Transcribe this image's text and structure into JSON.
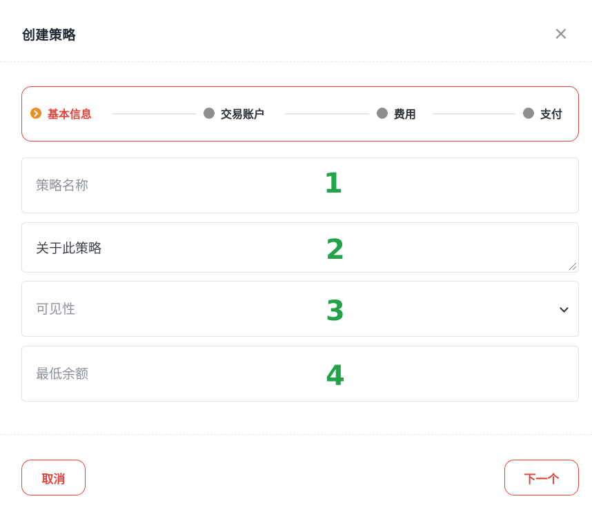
{
  "dialog": {
    "title": "创建策略",
    "close_glyph": "×"
  },
  "steps": [
    {
      "label": "基本信息",
      "active": true
    },
    {
      "label": "交易账户",
      "active": false
    },
    {
      "label": "费用",
      "active": false
    },
    {
      "label": "支付",
      "active": false
    }
  ],
  "form": {
    "name": {
      "placeholder": "策略名称",
      "badge": "1"
    },
    "about": {
      "placeholder": "关于此策略",
      "badge": "2"
    },
    "visibility": {
      "placeholder": "可见性",
      "badge": "3"
    },
    "min_balance": {
      "placeholder": "最低余额",
      "badge": "4"
    }
  },
  "footer": {
    "cancel_label": "取消",
    "next_label": "下一个"
  },
  "colors": {
    "accent": "#e0453a",
    "active_step": "#f08a24",
    "badge": "#22a34a",
    "inactive_dot": "#8f8f8f"
  }
}
